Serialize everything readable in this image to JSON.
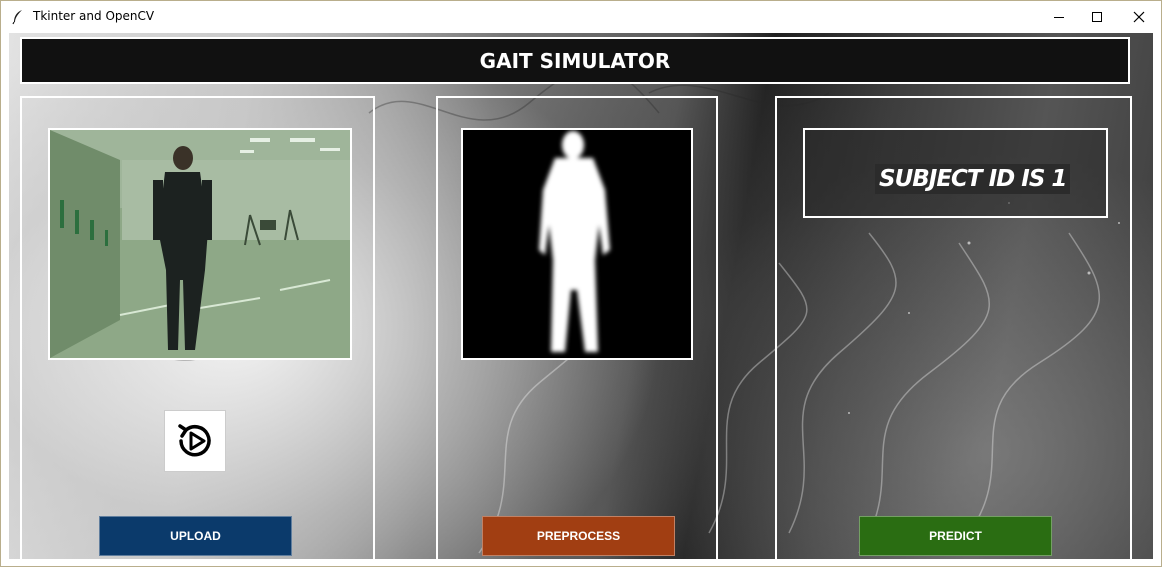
{
  "window": {
    "title": "Tkinter and OpenCV"
  },
  "header": {
    "title": "GAIT SIMULATOR"
  },
  "panels": {
    "upload": {
      "button_label": "UPLOAD",
      "button_color": "#0b3a6b",
      "replay_icon": "replay-play-icon",
      "video_frame": "walking-person-video-frame"
    },
    "preprocess": {
      "button_label": "PREPROCESS",
      "button_color": "#a13e12",
      "silhouette_frame": "silhouette-mask-frame"
    },
    "predict": {
      "button_label": "PREDICT",
      "button_color": "#2a6d12",
      "result_text": "SUBJECT ID IS 1"
    }
  }
}
